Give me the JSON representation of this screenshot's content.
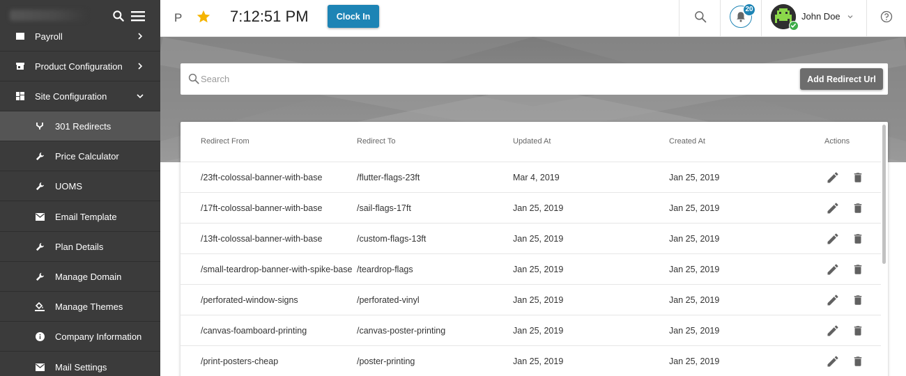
{
  "sidebar": {
    "items": [
      {
        "label": "Payroll",
        "icon": "payroll-icon"
      },
      {
        "label": "Product Configuration",
        "icon": "store-icon"
      },
      {
        "label": "Site Configuration",
        "icon": "dashboard-icon"
      }
    ],
    "sub_items": [
      {
        "label": "301 Redirects",
        "icon": "redirect-icon"
      },
      {
        "label": "Price Calculator",
        "icon": "wrench-icon"
      },
      {
        "label": "UOMS",
        "icon": "wrench-icon"
      },
      {
        "label": "Email Template",
        "icon": "mail-icon"
      },
      {
        "label": "Plan Details",
        "icon": "wrench-icon"
      },
      {
        "label": "Manage Domain",
        "icon": "wrench-icon"
      },
      {
        "label": "Manage Themes",
        "icon": "paint-bucket-icon"
      },
      {
        "label": "Company Information",
        "icon": "info-icon"
      },
      {
        "label": "Mail Settings",
        "icon": "mail-icon"
      }
    ]
  },
  "topbar": {
    "initial": "P",
    "time": "7:12:51 PM",
    "clock_in_label": "Clock In",
    "notifications_count": "20",
    "user_name": "John Doe"
  },
  "search": {
    "placeholder": "Search",
    "add_button_label": "Add Redirect Url"
  },
  "table": {
    "headers": [
      "Redirect From",
      "Redirect To",
      "Updated At",
      "Created At",
      "Actions"
    ],
    "rows": [
      [
        "/23ft-colossal-banner-with-base",
        "/flutter-flags-23ft",
        "Mar 4, 2019",
        "Jan 25, 2019"
      ],
      [
        "/17ft-colossal-banner-with-base",
        "/sail-flags-17ft",
        "Jan 25, 2019",
        "Jan 25, 2019"
      ],
      [
        "/13ft-colossal-banner-with-base",
        "/custom-flags-13ft",
        "Jan 25, 2019",
        "Jan 25, 2019"
      ],
      [
        "/small-teardrop-banner-with-spike-base",
        "/teardrop-flags",
        "Jan 25, 2019",
        "Jan 25, 2019"
      ],
      [
        "/perforated-window-signs",
        "/perforated-vinyl",
        "Jan 25, 2019",
        "Jan 25, 2019"
      ],
      [
        "/canvas-foamboard-printing",
        "/canvas-poster-printing",
        "Jan 25, 2019",
        "Jan 25, 2019"
      ],
      [
        "/print-posters-cheap",
        "/poster-printing",
        "Jan 25, 2019",
        "Jan 25, 2019"
      ]
    ]
  },
  "colors": {
    "sidebar_bg": "#3b3b3b",
    "sidebar_active": "#555555",
    "primary": "#1d84b5",
    "star": "#f5b400",
    "add_button": "#6d6d6d",
    "status_online": "#3fae49"
  }
}
